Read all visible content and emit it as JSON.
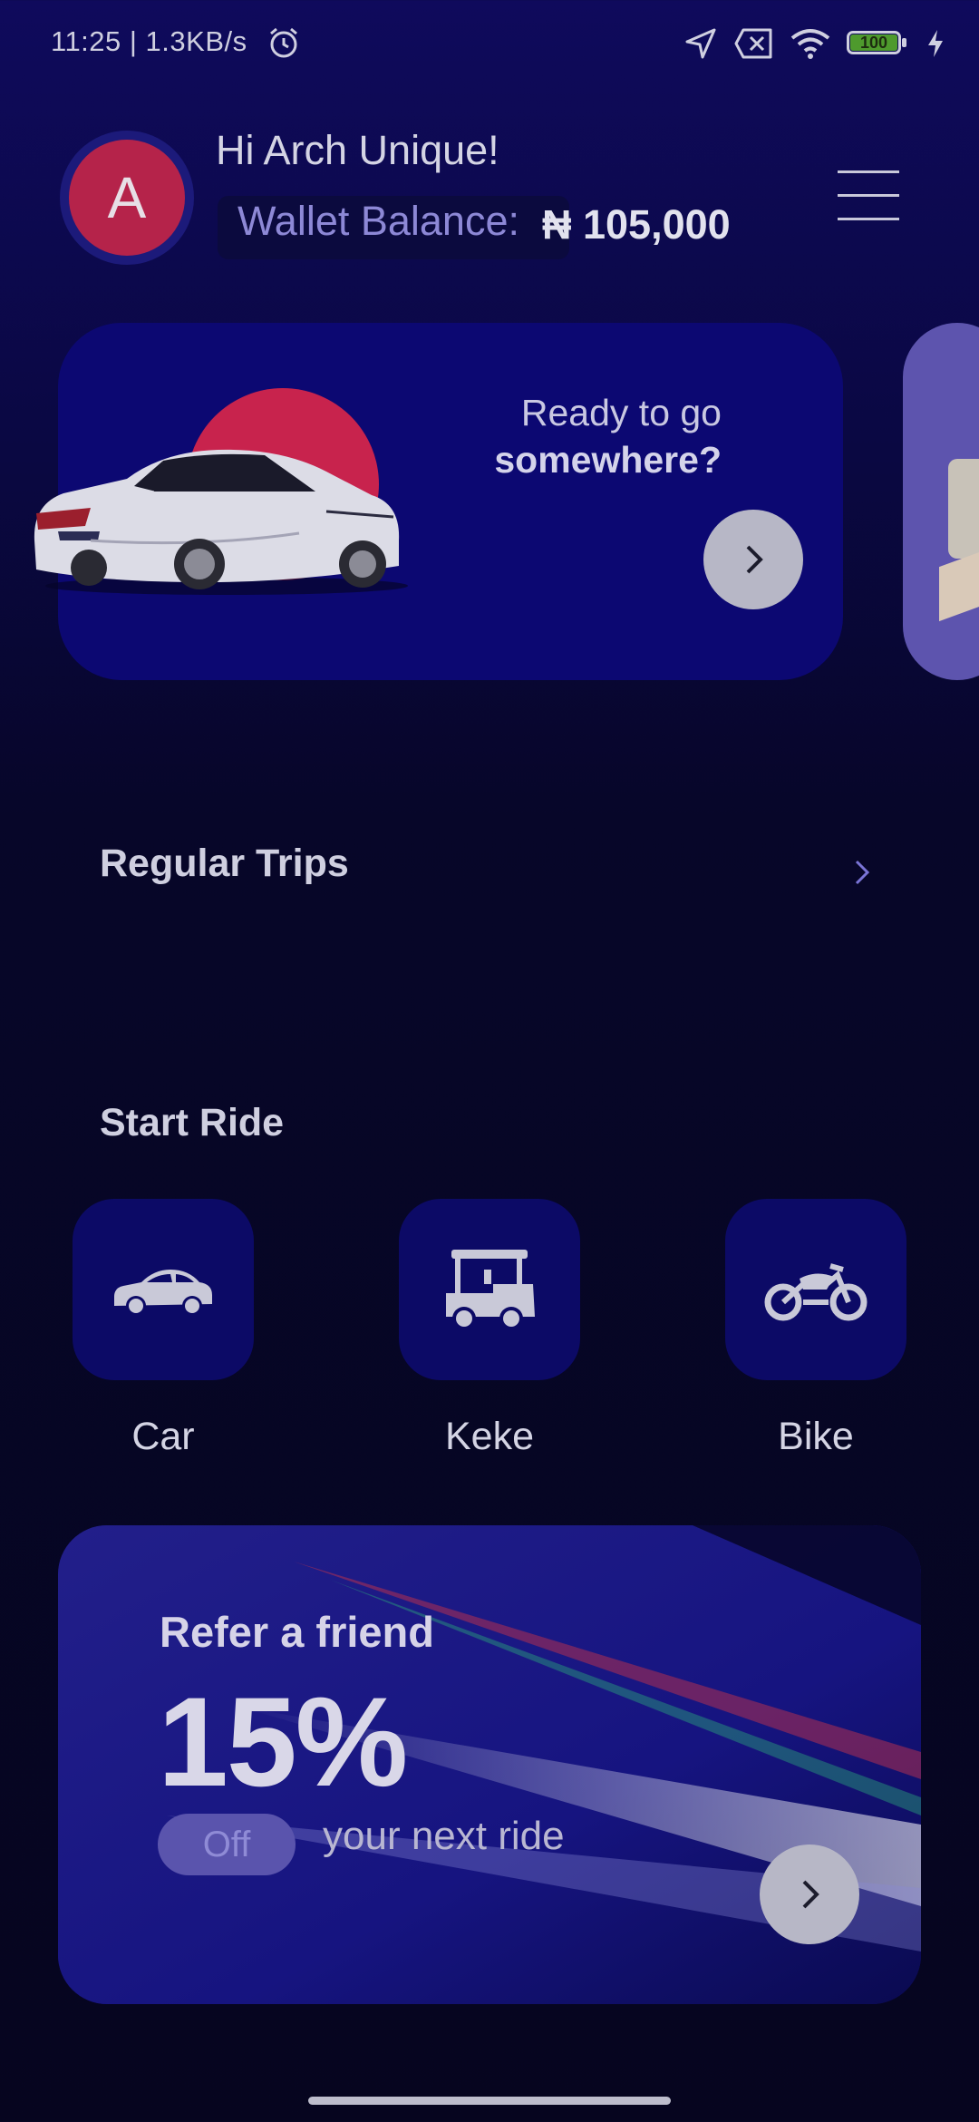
{
  "status_bar": {
    "text": "11:25 | 1.3KB/s",
    "battery": "100",
    "icons": [
      "alarm-icon",
      "location-arrow-icon",
      "sim-off-icon",
      "wifi-icon",
      "battery-icon",
      "charging-icon"
    ]
  },
  "header": {
    "avatar_initial": "A",
    "greeting": "Hi Arch Unique!",
    "wallet_label": "Wallet Balance:",
    "wallet_value": "₦ 105,000",
    "menu_icon": "hamburger-menu-icon"
  },
  "promo": {
    "line1": "Ready to go",
    "line2": "somewhere?",
    "accent_color": "#c8234d"
  },
  "regular_trips": {
    "title": "Regular Trips"
  },
  "start_ride": {
    "title": "Start Ride",
    "options": [
      {
        "label": "Car",
        "icon": "car-icon"
      },
      {
        "label": "Keke",
        "icon": "keke-icon"
      },
      {
        "label": "Bike",
        "icon": "motorbike-icon"
      }
    ]
  },
  "refer": {
    "title": "Refer a friend",
    "percent": "15%",
    "badge": "Off",
    "subtitle": "your next ride"
  },
  "colors": {
    "background": "#0a0842",
    "card": "#0c0872",
    "avatar": "#b5234a",
    "button": "#b7b7c6"
  }
}
